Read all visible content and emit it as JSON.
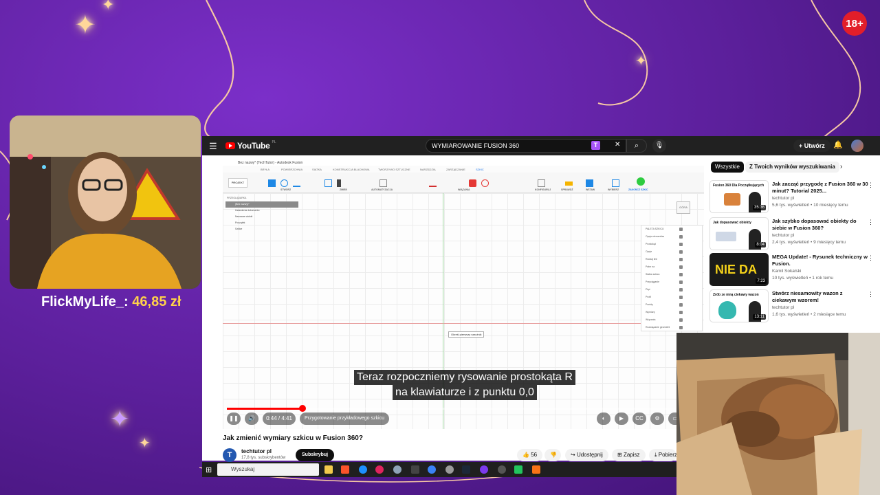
{
  "overlay": {
    "age_badge": "18+",
    "donor_name": "FlickMyLife_:",
    "donor_amount": "46,85 zł"
  },
  "youtube": {
    "logo_text": "YouTube",
    "logo_region": "PL",
    "search_value": "WYMIAROWANIE FUSION 360",
    "create_label": "Utwórz",
    "video": {
      "fusion_window_title": "Bez nazwy* (TechTutor) - Autodesk Fusion",
      "file_tab": "Bez nazwy*",
      "workspace_tabs": [
        "BRYŁA",
        "POWIERZCHNIA",
        "SIATKA",
        "KONSTRUKCJA BLACHOWA",
        "TWORZYWO SZTUCZNE",
        "NARZĘDZIA",
        "ZARZĄDZANIE",
        "SZKIC"
      ],
      "tool_groups": [
        "PROJEKT",
        "STWÓRZ",
        "ZMIEŃ",
        "AUTOMATYZACJA",
        "WIĄZANIA",
        "KONFIGURUJ",
        "SPRAWDŹ",
        "WSTAW",
        "WYBIERZ",
        "ZAKOŃCZ SZKIC"
      ],
      "browser_title": "PRZEGLĄDARKA",
      "browser_items": [
        "(Bez nazwy)*",
        "Ustawienia dokumentu",
        "Nazwane widoki",
        "Początek",
        "Szkice"
      ],
      "sketch_palette_title": "PALETA SZKICU",
      "sketch_palette_items": [
        "Opcje elementów",
        "Prostokąt",
        "Opcje",
        "Rodzaj linii",
        "Patrz na",
        "Siatka szkicu",
        "Przyciąganie",
        "Pięć",
        "Profil",
        "Punkty",
        "Wymiary",
        "Wiązania",
        "Rozwiązanie geometrii"
      ],
      "view_cube_label": "GÓRA",
      "cursor_tooltip": "Określ pierwszy narożnik",
      "subtitle_line1": "Teraz rozpoczniemy rysowanie prostokąta R",
      "subtitle_line2": "na klawiaturze i z punktu 0,0",
      "time": "0:44 / 4:41",
      "chapter": "Przygotowanie przykładowego szkicu",
      "progress_fraction": 0.16
    },
    "video_title": "Jak zmienić wymiary szkicu w Fusion 360?",
    "channel": {
      "initial": "T",
      "name": "techtutor pl",
      "subscribers": "17,8 tys. subskrybentów",
      "subscribe_label": "Subskrybuj"
    },
    "actions": {
      "likes": "56",
      "share": "Udostępnij",
      "save": "Zapisz",
      "download": "Pobierz"
    },
    "chips": [
      "Wszystkie",
      "Z Twoich wyników wyszukiwania"
    ],
    "recommendations": [
      {
        "title": "Jak zacząć przygodę z Fusion 360 w 30 minut? Tutorial 2025...",
        "channel": "techtutor pl",
        "meta": "5,6 tys. wyświetleń • 10 miesięcy temu",
        "duration": "35:36",
        "thumb_text": "Fusion 360 Dla Początkujących",
        "thumb_color": "#ffffff"
      },
      {
        "title": "Jak szybko dopasować obiekty do siebie w Fusion 360?",
        "channel": "techtutor pl",
        "meta": "2,4 tys. wyświetleń • 9 miesięcy temu",
        "duration": "8:04",
        "thumb_text": "Jak dopasować obiekty",
        "thumb_color": "#ffffff"
      },
      {
        "title": "MEGA Update! - Rysunek techniczny w Fusion.",
        "channel": "Kamil Sokalski",
        "meta": "10 tys. wyświetleń • 1 rok temu",
        "duration": "7:23",
        "thumb_text": "NIE DA",
        "thumb_color": "#1a1a1a"
      },
      {
        "title": "Stwórz niesamowity wazon z ciekawym wzorem!",
        "channel": "techtutor pl",
        "meta": "1,6 tys. wyświetleń • 2 miesiące temu",
        "duration": "13:11",
        "thumb_text": "Zrób ze mną ciekawy wazon",
        "thumb_color": "#ffffff"
      }
    ]
  },
  "taskbar": {
    "search_placeholder": "Wyszukaj"
  }
}
